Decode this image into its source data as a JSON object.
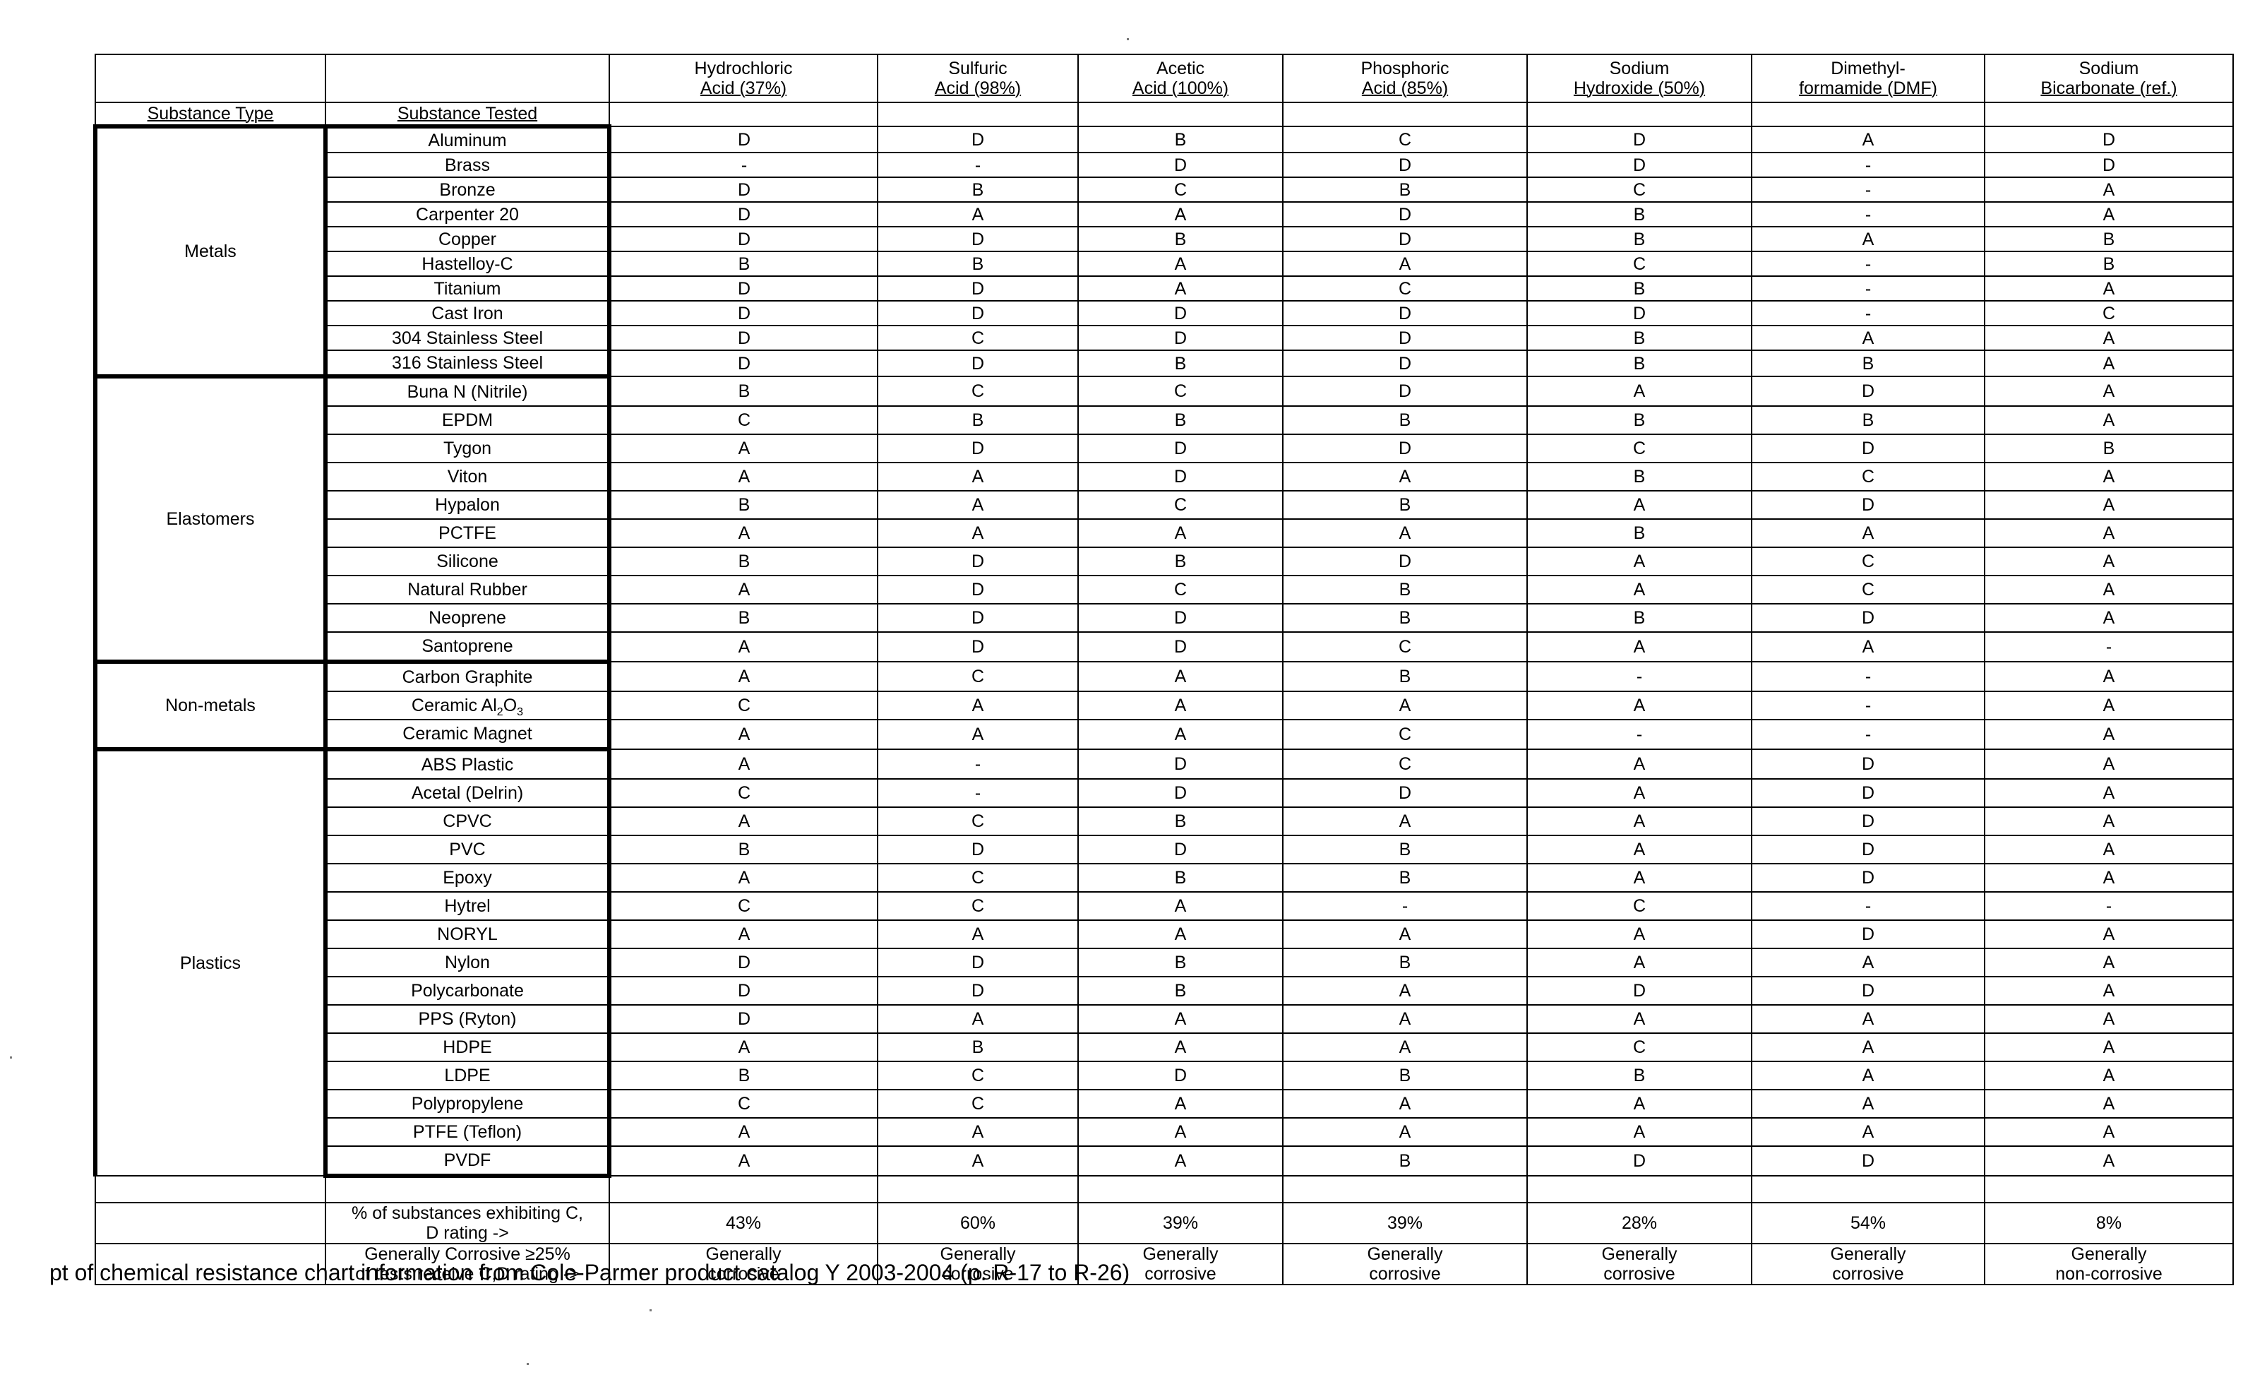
{
  "header": {
    "substance_type": "Substance Type",
    "substance_tested": "Substance Tested",
    "chemicals": [
      {
        "line1": "Hydrochloric",
        "line2": "Acid (37%)"
      },
      {
        "line1": "Sulfuric",
        "line2": "Acid (98%)"
      },
      {
        "line1": "Acetic",
        "line2": "Acid (100%)"
      },
      {
        "line1": "Phosphoric",
        "line2": "Acid (85%)"
      },
      {
        "line1": "Sodium",
        "line2": "Hydroxide (50%)"
      },
      {
        "line1": "Dimethyl-",
        "line2": "formamide (DMF)"
      },
      {
        "line1": "Sodium",
        "line2": "Bicarbonate (ref.)"
      }
    ]
  },
  "groups": [
    {
      "type": "Metals",
      "rows": [
        {
          "name": "Aluminum",
          "ratings": [
            "D",
            "D",
            "B",
            "C",
            "D",
            "A",
            "D"
          ]
        },
        {
          "name": "Brass",
          "ratings": [
            "-",
            "-",
            "D",
            "D",
            "D",
            "-",
            "D"
          ]
        },
        {
          "name": "Bronze",
          "ratings": [
            "D",
            "B",
            "C",
            "B",
            "C",
            "-",
            "A"
          ]
        },
        {
          "name": "Carpenter 20",
          "ratings": [
            "D",
            "A",
            "A",
            "D",
            "B",
            "-",
            "A"
          ]
        },
        {
          "name": "Copper",
          "ratings": [
            "D",
            "D",
            "B",
            "D",
            "B",
            "A",
            "B"
          ]
        },
        {
          "name": "Hastelloy-C",
          "ratings": [
            "B",
            "B",
            "A",
            "A",
            "C",
            "-",
            "B"
          ]
        },
        {
          "name": "Titanium",
          "ratings": [
            "D",
            "D",
            "A",
            "C",
            "B",
            "-",
            "A"
          ]
        },
        {
          "name": "Cast Iron",
          "ratings": [
            "D",
            "D",
            "D",
            "D",
            "D",
            "-",
            "C"
          ]
        },
        {
          "name": "304 Stainless Steel",
          "ratings": [
            "D",
            "C",
            "D",
            "D",
            "B",
            "A",
            "A"
          ]
        },
        {
          "name": "316 Stainless Steel",
          "ratings": [
            "D",
            "D",
            "B",
            "D",
            "B",
            "B",
            "A"
          ]
        }
      ]
    },
    {
      "type": "Elastomers",
      "rows": [
        {
          "name": "Buna N (Nitrile)",
          "ratings": [
            "B",
            "C",
            "C",
            "D",
            "A",
            "D",
            "A"
          ]
        },
        {
          "name": "EPDM",
          "ratings": [
            "C",
            "B",
            "B",
            "B",
            "B",
            "B",
            "A"
          ]
        },
        {
          "name": "Tygon",
          "ratings": [
            "A",
            "D",
            "D",
            "D",
            "C",
            "D",
            "B"
          ]
        },
        {
          "name": "Viton",
          "ratings": [
            "A",
            "A",
            "D",
            "A",
            "B",
            "C",
            "A"
          ]
        },
        {
          "name": "Hypalon",
          "ratings": [
            "B",
            "A",
            "C",
            "B",
            "A",
            "D",
            "A"
          ]
        },
        {
          "name": "PCTFE",
          "ratings": [
            "A",
            "A",
            "A",
            "A",
            "B",
            "A",
            "A"
          ]
        },
        {
          "name": "Silicone",
          "ratings": [
            "B",
            "D",
            "B",
            "D",
            "A",
            "C",
            "A"
          ]
        },
        {
          "name": "Natural Rubber",
          "ratings": [
            "A",
            "D",
            "C",
            "B",
            "A",
            "C",
            "A"
          ]
        },
        {
          "name": "Neoprene",
          "ratings": [
            "B",
            "D",
            "D",
            "B",
            "B",
            "D",
            "A"
          ]
        },
        {
          "name": "Santoprene",
          "ratings": [
            "A",
            "D",
            "D",
            "C",
            "A",
            "A",
            "-"
          ]
        }
      ]
    },
    {
      "type": "Non-metals",
      "rows": [
        {
          "name": "Carbon Graphite",
          "ratings": [
            "A",
            "C",
            "A",
            "B",
            "-",
            "-",
            "A"
          ]
        },
        {
          "name": "Ceramic Al",
          "name_sub": "2",
          "name_tail": "O",
          "name_sub2": "3",
          "ratings": [
            "C",
            "A",
            "A",
            "A",
            "A",
            "-",
            "A"
          ]
        },
        {
          "name": "Ceramic Magnet",
          "ratings": [
            "A",
            "A",
            "A",
            "C",
            "-",
            "-",
            "A"
          ]
        }
      ]
    },
    {
      "type": "Plastics",
      "rows": [
        {
          "name": "ABS Plastic",
          "ratings": [
            "A",
            "-",
            "D",
            "C",
            "A",
            "D",
            "A"
          ]
        },
        {
          "name": "Acetal (Delrin)",
          "ratings": [
            "C",
            "-",
            "D",
            "D",
            "A",
            "D",
            "A"
          ]
        },
        {
          "name": "CPVC",
          "ratings": [
            "A",
            "C",
            "B",
            "A",
            "A",
            "D",
            "A"
          ]
        },
        {
          "name": "PVC",
          "ratings": [
            "B",
            "D",
            "D",
            "B",
            "A",
            "D",
            "A"
          ]
        },
        {
          "name": "Epoxy",
          "ratings": [
            "A",
            "C",
            "B",
            "B",
            "A",
            "D",
            "A"
          ]
        },
        {
          "name": "Hytrel",
          "ratings": [
            "C",
            "C",
            "A",
            "-",
            "C",
            "-",
            "-"
          ]
        },
        {
          "name": "NORYL",
          "ratings": [
            "A",
            "A",
            "A",
            "A",
            "A",
            "D",
            "A"
          ]
        },
        {
          "name": "Nylon",
          "ratings": [
            "D",
            "D",
            "B",
            "B",
            "A",
            "A",
            "A"
          ]
        },
        {
          "name": "Polycarbonate",
          "ratings": [
            "D",
            "D",
            "B",
            "A",
            "D",
            "D",
            "A"
          ]
        },
        {
          "name": "PPS (Ryton)",
          "ratings": [
            "D",
            "A",
            "A",
            "A",
            "A",
            "A",
            "A"
          ]
        },
        {
          "name": "HDPE",
          "ratings": [
            "A",
            "B",
            "A",
            "A",
            "C",
            "A",
            "A"
          ]
        },
        {
          "name": "LDPE",
          "ratings": [
            "B",
            "C",
            "D",
            "B",
            "B",
            "A",
            "A"
          ]
        },
        {
          "name": "Polypropylene",
          "ratings": [
            "C",
            "C",
            "A",
            "A",
            "A",
            "A",
            "A"
          ]
        },
        {
          "name": "PTFE (Teflon)",
          "ratings": [
            "A",
            "A",
            "A",
            "A",
            "A",
            "A",
            "A"
          ]
        },
        {
          "name": "PVDF",
          "ratings": [
            "A",
            "A",
            "A",
            "B",
            "D",
            "D",
            "A"
          ]
        }
      ]
    }
  ],
  "summary": {
    "percent_label_1": "% of substances exhibiting C,",
    "percent_label_2": "D rating ->",
    "percent_values": [
      "43%",
      "60%",
      "39%",
      "39%",
      "28%",
      "54%",
      "8%"
    ],
    "corrosive_label_1": "Generally Corrosive    ≥25%",
    "corrosive_label_2": "of tests receive C,D rating ->",
    "corrosive_values": [
      {
        "line1": "Generally",
        "line2": "corrosive"
      },
      {
        "line1": "Generally",
        "line2": "corrosive"
      },
      {
        "line1": "Generally",
        "line2": "corrosive"
      },
      {
        "line1": "Generally",
        "line2": "corrosive"
      },
      {
        "line1": "Generally",
        "line2": "corrosive"
      },
      {
        "line1": "Generally",
        "line2": "corrosive"
      },
      {
        "line1": "Generally",
        "line2": "non-corrosive"
      }
    ]
  },
  "footnote": "pt of chemical resistance chart information from Cole-Parmer product catalog Y 2003-2004 (p. R-17 to R-26)"
}
